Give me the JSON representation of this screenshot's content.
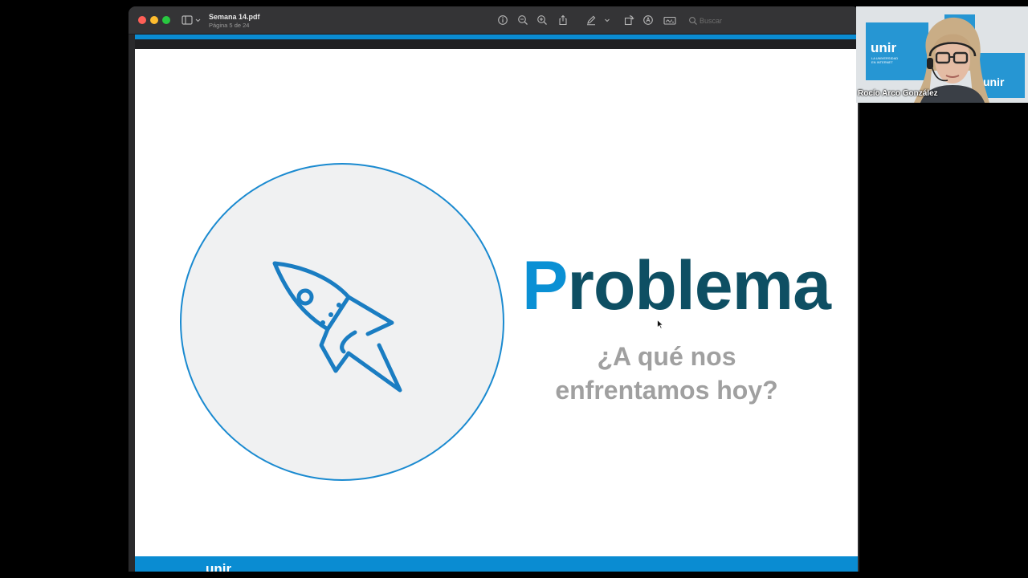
{
  "window": {
    "title": "Semana 14.pdf",
    "subtitle": "Página 5 de 24",
    "search_placeholder": "Buscar"
  },
  "toolbar": {
    "icons": [
      "info-icon",
      "zoom-out-icon",
      "zoom-in-icon",
      "share-icon",
      "markup-pen-icon",
      "chevron-down-icon",
      "rotate-icon",
      "markup-circle-icon",
      "signature-icon",
      "search-icon"
    ]
  },
  "slide": {
    "heading_first_letter": "P",
    "heading_rest": "roblema",
    "subtitle_line1": "¿A qué nos",
    "subtitle_line2": "enfrentamos hoy?",
    "footer_logo": "unir",
    "illustration": "rocket-icon",
    "colors": {
      "accent_blue": "#0a90d4",
      "heading_teal": "#0e4f63",
      "subtitle_gray": "#a0a0a0",
      "circle_fill": "#f0f1f2"
    }
  },
  "webcam": {
    "participant_name": "Rocío Arco González",
    "logo_text": "unir",
    "logo_sub_line1": "LA UNIVERSIDAD",
    "logo_sub_line2": "EN INTERNET"
  }
}
